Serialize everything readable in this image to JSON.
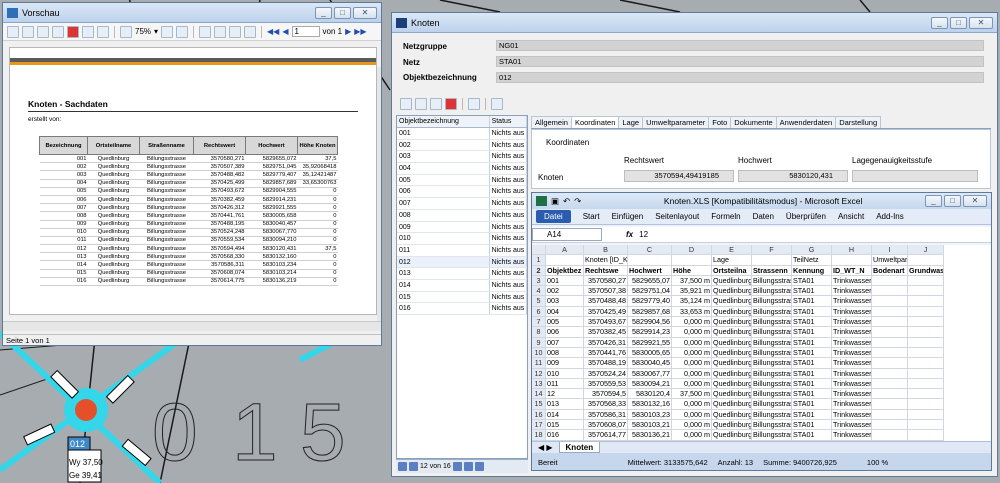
{
  "map": {
    "node_label": "012",
    "wy": "Wy 37,50",
    "ge": "Ge 39,41",
    "digits": [
      "0",
      "1",
      "5"
    ]
  },
  "vorschau": {
    "title": "Vorschau",
    "zoom": "75%",
    "page": "1",
    "page_of": "von 1",
    "doc_title": "Knoten - Sachdaten",
    "created": "erstellt von:",
    "headers": [
      "Bezeichnung",
      "Ortsteilname",
      "Straßenname",
      "Rechtswert",
      "Hochwert",
      "Höhe Knoten"
    ],
    "rows": [
      [
        "001",
        "Quedlinburg",
        "Billungsstrasse",
        "3570580,271",
        "5829655,072",
        "37,5"
      ],
      [
        "002",
        "Quedlinburg",
        "Billungsstrasse",
        "3570507,389",
        "5829751,045",
        "35,92068418"
      ],
      [
        "003",
        "Quedlinburg",
        "Billungsstrasse",
        "3570488,482",
        "5829779,407",
        "35,12421487"
      ],
      [
        "004",
        "Quedlinburg",
        "Billungsstrasse",
        "3570425,499",
        "5829857,689",
        "33,65300763"
      ],
      [
        "005",
        "Quedlinburg",
        "Billungsstrasse",
        "3570493,672",
        "5829904,555",
        "0"
      ],
      [
        "006",
        "Quedlinburg",
        "Billungsstrasse",
        "3570382,459",
        "5829914,231",
        "0"
      ],
      [
        "007",
        "Quedlinburg",
        "Billungsstrasse",
        "3570426,312",
        "5829921,555",
        "0"
      ],
      [
        "008",
        "Quedlinburg",
        "Billungsstrasse",
        "3570441,761",
        "5830005,658",
        "0"
      ],
      [
        "009",
        "Quedlinburg",
        "Billungsstrasse",
        "3570488,195",
        "5830040,457",
        "0"
      ],
      [
        "010",
        "Quedlinburg",
        "Billungsstrasse",
        "3570524,248",
        "5830067,770",
        "0"
      ],
      [
        "011",
        "Quedlinburg",
        "Billungsstrasse",
        "3570559,534",
        "5830094,210",
        "0"
      ],
      [
        "012",
        "Quedlinburg",
        "Billungsstrasse",
        "3570594,494",
        "5830120,431",
        "37,5"
      ],
      [
        "013",
        "Quedlinburg",
        "Billungsstrasse",
        "3570568,330",
        "5830132,160",
        "0"
      ],
      [
        "014",
        "Quedlinburg",
        "Billungsstrasse",
        "3570586,311",
        "5830103,234",
        "0"
      ],
      [
        "015",
        "Quedlinburg",
        "Billungsstrasse",
        "3570608,074",
        "5830103,214",
        "0"
      ],
      [
        "016",
        "Quedlinburg",
        "Billungsstrasse",
        "3570614,775",
        "5830136,219",
        "0"
      ]
    ],
    "status": "Seite 1 von 1"
  },
  "knoten": {
    "title": "Knoten",
    "fields": [
      {
        "label": "Netzgruppe",
        "value": "NG01"
      },
      {
        "label": "Netz",
        "value": "STA01"
      },
      {
        "label": "Objektbezeichnung",
        "value": "012"
      }
    ],
    "list_headers": [
      "Objektbezeichnung",
      "Status"
    ],
    "list": [
      "001",
      "002",
      "003",
      "004",
      "005",
      "006",
      "007",
      "008",
      "009",
      "010",
      "011",
      "012",
      "013",
      "014",
      "015",
      "016"
    ],
    "list_status": "Nichts aus",
    "nav_text": "12 von 16",
    "tabs": [
      "Allgemein",
      "Koordinaten",
      "Lage",
      "Umweltparameter",
      "Foto",
      "Dokumente",
      "Anwenderdaten",
      "Darstellung"
    ],
    "koord_title": "Koordinaten",
    "col_rechts": "Rechtswert",
    "col_hoch": "Hochwert",
    "col_lage": "Lagegenauigkeitsstufe",
    "row_label": "Knoten",
    "rechts": "3570594,49419185",
    "hoch": "5830120,431"
  },
  "excel": {
    "title": "Knoten.XLS  [Kompatibilitätsmodus] - Microsoft Excel",
    "ribbon": [
      "Datei",
      "Start",
      "Einfügen",
      "Seitenlayout",
      "Formeln",
      "Daten",
      "Überprüfen",
      "Ansicht",
      "Add-Ins"
    ],
    "namebox": "A14",
    "formula": "12",
    "cols": [
      "A",
      "B",
      "C",
      "D",
      "E",
      "F",
      "G",
      "H",
      "I",
      "J"
    ],
    "row1": [
      "",
      "Knoten [ID_Knoten]",
      "",
      "",
      "Lage",
      "",
      "TeilNetz",
      "",
      "Umweltparameter [ID",
      ""
    ],
    "row2": [
      "Objektbez",
      "Rechtswe",
      "Hochwert",
      "Höhe",
      "Ortsteilna",
      "Strassenn",
      "Kennung",
      "ID_WT_N",
      "Bodenart",
      "Grundwas"
    ],
    "rows": [
      [
        "001",
        "3570580,27",
        "5829655,07",
        "37,500 m",
        "Quedlinburg",
        "Billungsstrass",
        "STA01",
        "Trinkwasser",
        "",
        ""
      ],
      [
        "002",
        "3570507,38",
        "5829751,04",
        "35,921 m",
        "Quedlinburg",
        "Billungsstrass",
        "STA01",
        "Trinkwasser",
        "",
        ""
      ],
      [
        "003",
        "3570488,48",
        "5829779,40",
        "35,124 m",
        "Quedlinburg",
        "Billungsstrass",
        "STA01",
        "Trinkwasser",
        "",
        ""
      ],
      [
        "004",
        "3570425,49",
        "5829857,68",
        "33,653 m",
        "Quedlinburg",
        "Billungsstrass",
        "STA01",
        "Trinkwasser",
        "",
        ""
      ],
      [
        "005",
        "3570493,67",
        "5829904,56",
        "0,000 m",
        "Quedlinburg",
        "Billungsstrass",
        "STA01",
        "Trinkwasser",
        "",
        ""
      ],
      [
        "006",
        "3570382,45",
        "5829914,23",
        "0,000 m",
        "Quedlinburg",
        "Billungsstrass",
        "STA01",
        "Trinkwasser",
        "",
        ""
      ],
      [
        "007",
        "3570426,31",
        "5829921,55",
        "0,000 m",
        "Quedlinburg",
        "Billungsstrass",
        "STA01",
        "Trinkwasser",
        "",
        ""
      ],
      [
        "008",
        "3570441,76",
        "5830005,65",
        "0,000 m",
        "Quedlinburg",
        "Billungsstrass",
        "STA01",
        "Trinkwasser",
        "",
        ""
      ],
      [
        "009",
        "3570488,19",
        "5830040,45",
        "0,000 m",
        "Quedlinburg",
        "Billungsstrass",
        "STA01",
        "Trinkwasser",
        "",
        ""
      ],
      [
        "010",
        "3570524,24",
        "5830067,77",
        "0,000 m",
        "Quedlinburg",
        "Billungsstrass",
        "STA01",
        "Trinkwasser",
        "",
        ""
      ],
      [
        "011",
        "3570559,53",
        "5830094,21",
        "0,000 m",
        "Quedlinburg",
        "Billungsstrass",
        "STA01",
        "Trinkwasser",
        "",
        ""
      ],
      [
        "12",
        "3570594,5",
        "5830120,4",
        "37,500 m",
        "Quedlinburg",
        "Billungsstrass",
        "STA01",
        "Trinkwasser",
        "",
        ""
      ],
      [
        "013",
        "3570568,33",
        "5830132,16",
        "0,000 m",
        "Quedlinburg",
        "Billungsstrass",
        "STA01",
        "Trinkwasser",
        "",
        ""
      ],
      [
        "014",
        "3570586,31",
        "5830103,23",
        "0,000 m",
        "Quedlinburg",
        "Billungsstrass",
        "STA01",
        "Trinkwasser",
        "",
        ""
      ],
      [
        "015",
        "3570608,07",
        "5830103,21",
        "0,000 m",
        "Quedlinburg",
        "Billungsstrass",
        "STA01",
        "Trinkwasser",
        "",
        ""
      ],
      [
        "016",
        "3570614,77",
        "5830136,21",
        "0,000 m",
        "Quedlinburg",
        "Billungsstrass",
        "STA01",
        "Trinkwasser",
        "",
        ""
      ]
    ],
    "sheet": "Knoten",
    "status_ready": "Bereit",
    "status_mean": "Mittelwert: 3133575,642",
    "status_count": "Anzahl: 13",
    "status_sum": "Summe: 9400726,925",
    "zoom": "100 %"
  }
}
